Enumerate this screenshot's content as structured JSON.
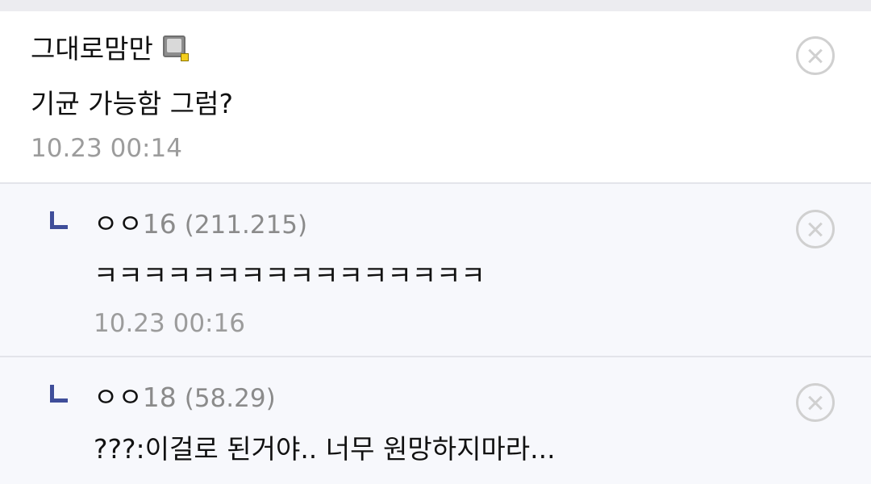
{
  "comments": [
    {
      "author": "그대로맘만",
      "author_icon": "gallog-icon",
      "text": "기균 가능함 그럼?",
      "date": "10.23 00:14"
    }
  ],
  "replies": [
    {
      "nick_prefix": "ㅇㅇ",
      "nick_num": "16",
      "ip": "(211.215)",
      "text": "ㅋㅋㅋㅋㅋㅋㅋㅋㅋㅋㅋㅋㅋㅋㅋㅋ",
      "date": "10.23 00:16"
    },
    {
      "nick_prefix": "ㅇㅇ",
      "nick_num": "18",
      "ip": "(58.29)",
      "text": "???:이걸로 된거야.. 너무 원망하지마라...",
      "date": ""
    }
  ],
  "icons": {
    "reply": "reply-arrow-icon",
    "delete": "close-circle-icon"
  },
  "colors": {
    "reply_bg": "#f7f8fc",
    "reply_arrow": "#3f4e9a",
    "meta_gray": "#9c9c9c"
  }
}
